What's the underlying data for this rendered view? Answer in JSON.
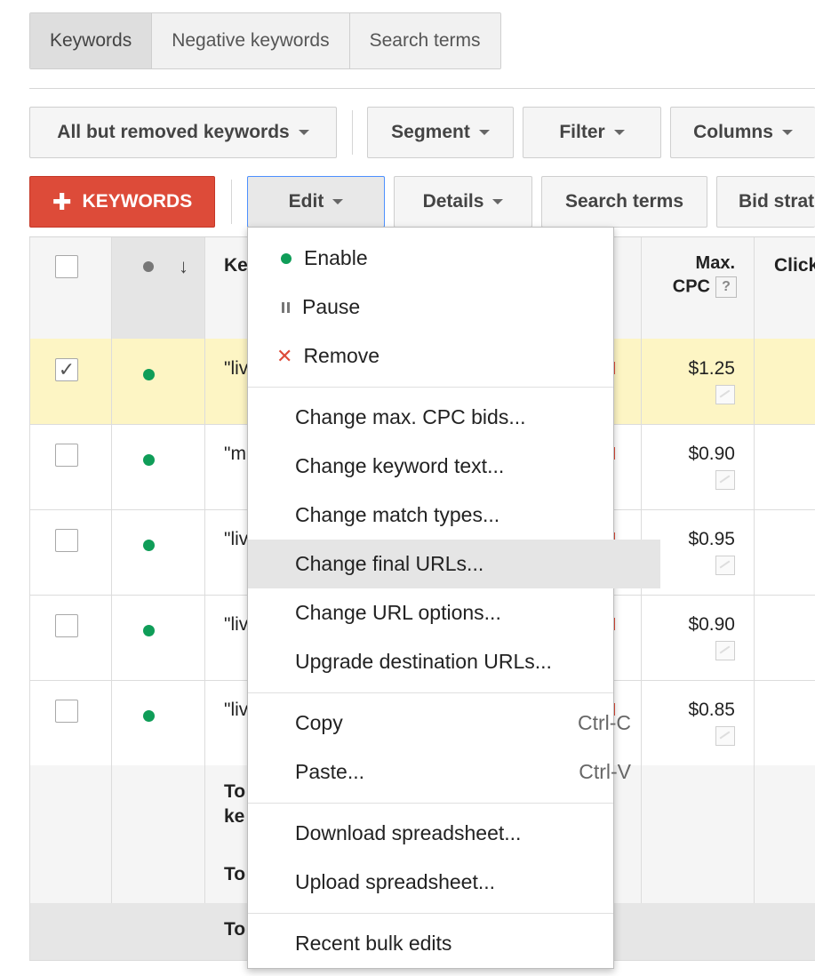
{
  "tabs": [
    "Keywords",
    "Negative keywords",
    "Search terms"
  ],
  "toolbar1": {
    "filter_view": "All but removed keywords",
    "segment": "Segment",
    "filter": "Filter",
    "columns": "Columns"
  },
  "toolbar2": {
    "add_keywords": "KEYWORDS",
    "edit": "Edit",
    "details": "Details",
    "search_terms": "Search terms",
    "bid_strategy": "Bid strat"
  },
  "table": {
    "headers": {
      "keyword": "Ke",
      "max_cpc_line1": "Max.",
      "max_cpc_line2": "CPC",
      "help": "?",
      "clicks": "Click"
    },
    "rows": [
      {
        "keyword": "\"liv",
        "max_cpc": "$1.25",
        "checked": true
      },
      {
        "keyword": "\"m",
        "max_cpc": "$0.90",
        "checked": false
      },
      {
        "keyword": "\"liv",
        "max_cpc": "$0.95",
        "checked": false
      },
      {
        "keyword": "\"liv",
        "max_cpc": "$0.90",
        "checked": false
      },
      {
        "keyword": "\"liv",
        "max_cpc": "$0.85",
        "checked": false
      }
    ],
    "totals": [
      {
        "line1": "To",
        "line2": "ke"
      },
      {
        "line1": "To"
      },
      {
        "line1": "To"
      }
    ]
  },
  "menu": {
    "enable": "Enable",
    "pause": "Pause",
    "remove": "Remove",
    "change_max_cpc": "Change max. CPC bids...",
    "change_keyword_text": "Change keyword text...",
    "change_match_types": "Change match types...",
    "change_final_urls": "Change final URLs...",
    "change_url_options": "Change URL options...",
    "upgrade_destination_urls": "Upgrade destination URLs...",
    "copy": "Copy",
    "copy_shortcut": "Ctrl-C",
    "paste": "Paste...",
    "paste_shortcut": "Ctrl-V",
    "download_spreadsheet": "Download spreadsheet...",
    "upload_spreadsheet": "Upload spreadsheet...",
    "recent_bulk_edits": "Recent bulk edits"
  },
  "colors": {
    "accent_red": "#dd4b39",
    "status_green": "#0f9d58",
    "selected_row": "#fdf5c4",
    "focus_blue": "#4d90fe"
  }
}
